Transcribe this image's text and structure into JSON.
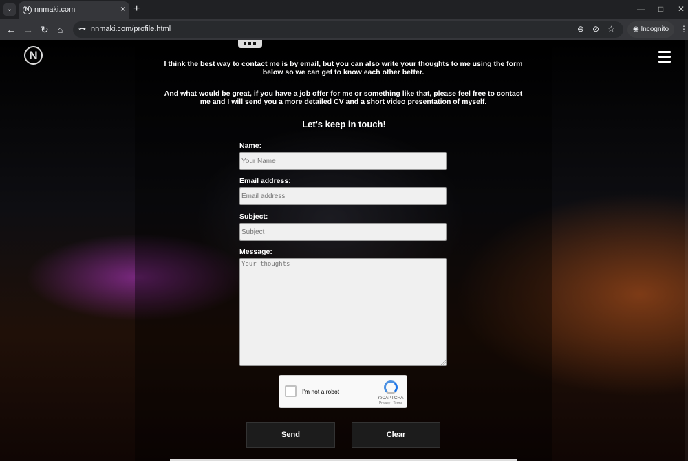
{
  "browser": {
    "tab_title": "nnmaki.com",
    "tab_close": "×",
    "new_tab": "+",
    "tab_search": "⌄",
    "minimize": "—",
    "maximize": "□",
    "close": "✕",
    "back": "←",
    "forward": "→",
    "reload": "↻",
    "home": "⌂",
    "site_info": "⊶",
    "url": "nnmaki.com/profile.html",
    "zoom_icon": "⊖",
    "eye_off_icon": "⊘",
    "star_icon": "☆",
    "profile_label": "Incognito",
    "menu": "⋮"
  },
  "site": {
    "logo": "N",
    "intro_paragraphs": [
      "I think the best way to contact me is by email, but you can also write your thoughts to me using the form below so we can get to know each other better.",
      "And what would be great, if you have a job offer for me or something like that, please feel free to contact me and I will send you a more detailed CV and a short video presentation of myself."
    ],
    "heading": "Let's keep in touch!"
  },
  "form": {
    "name_label": "Name:",
    "name_placeholder": "Your Name",
    "email_label": "Email address:",
    "email_placeholder": "Email address",
    "subject_label": "Subject:",
    "subject_placeholder": "Subject",
    "message_label": "Message:",
    "message_placeholder": "Your thoughts",
    "send": "Send",
    "clear": "Clear"
  },
  "captcha": {
    "label": "I'm not a robot",
    "brand": "reCAPTCHA",
    "terms": "Privacy - Terms"
  }
}
